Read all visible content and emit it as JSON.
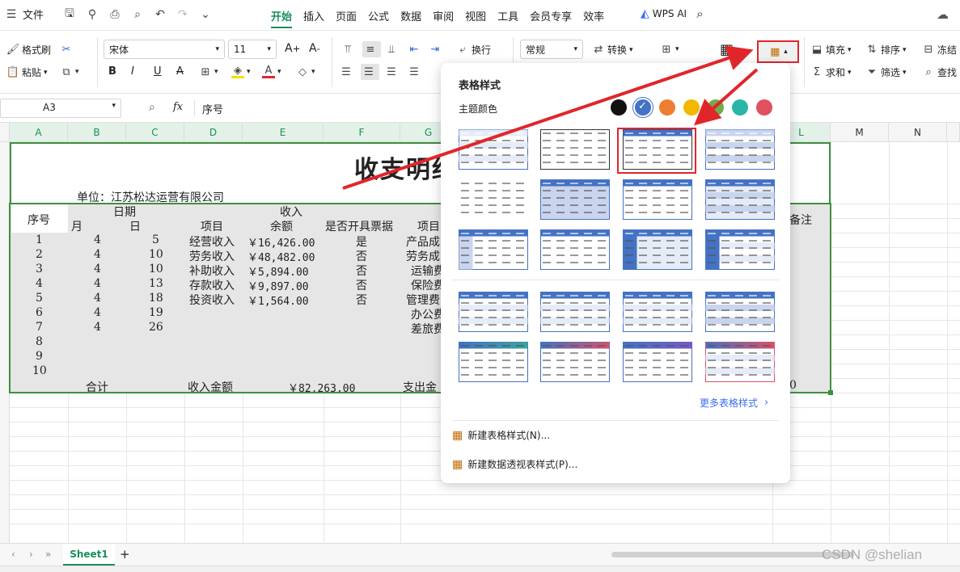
{
  "menu": {
    "file_label": "文件",
    "tabs": [
      "开始",
      "插入",
      "页面",
      "公式",
      "数据",
      "审阅",
      "视图",
      "工具",
      "会员专享",
      "效率"
    ],
    "wps_ai": "WPS AI"
  },
  "ribbon": {
    "format_painter": "格式刷",
    "paste": "粘贴",
    "font_name": "宋体",
    "font_size": "11",
    "bold": "B",
    "italic": "I",
    "underline": "U",
    "strike": "A",
    "wrap": "换行",
    "number_format": "常规",
    "convert": "转换",
    "fill": "填充",
    "sort": "排序",
    "freeze": "冻结",
    "sum": "求和",
    "filter": "筛选",
    "find": "查找"
  },
  "formula_bar": {
    "cell_ref": "A3",
    "fx": "fx",
    "content": "序号"
  },
  "columns": [
    "A",
    "B",
    "C",
    "D",
    "E",
    "F",
    "G",
    "L",
    "M",
    "N"
  ],
  "sheet": {
    "title": "收支明细",
    "unit": "单位：江苏松达运营有限公司",
    "header_seq": "序号",
    "header_date": "日期",
    "header_income": "收入",
    "header_month": "月",
    "header_day": "日",
    "header_item": "项目",
    "header_amount": "余额",
    "header_invoice": "是否开具票据",
    "header_item2": "项目",
    "header_note": "备注",
    "rows": [
      {
        "seq": "1",
        "m": "4",
        "d": "5",
        "item": "经营收入",
        "amt": "￥16,426.00",
        "inv": "是",
        "exp": "产品成"
      },
      {
        "seq": "2",
        "m": "4",
        "d": "10",
        "item": "劳务收入",
        "amt": "￥48,482.00",
        "inv": "否",
        "exp": "劳务成"
      },
      {
        "seq": "3",
        "m": "4",
        "d": "10",
        "item": "补助收入",
        "amt": "￥5,894.00",
        "inv": "否",
        "exp": "运输费"
      },
      {
        "seq": "4",
        "m": "4",
        "d": "13",
        "item": "存款收入",
        "amt": "￥9,897.00",
        "inv": "否",
        "exp": "保险费"
      },
      {
        "seq": "5",
        "m": "4",
        "d": "18",
        "item": "投资收入",
        "amt": "￥1,564.00",
        "inv": "否",
        "exp": "管理费"
      },
      {
        "seq": "6",
        "m": "4",
        "d": "19",
        "item": "",
        "amt": "",
        "inv": "",
        "exp": "办公费"
      },
      {
        "seq": "7",
        "m": "4",
        "d": "26",
        "item": "",
        "amt": "",
        "inv": "",
        "exp": "差旅费"
      },
      {
        "seq": "8",
        "m": "",
        "d": "",
        "item": "",
        "amt": "",
        "inv": "",
        "exp": ""
      },
      {
        "seq": "9",
        "m": "",
        "d": "",
        "item": "",
        "amt": "",
        "inv": "",
        "exp": ""
      },
      {
        "seq": "10",
        "m": "",
        "d": "",
        "item": "",
        "amt": "",
        "inv": "",
        "exp": ""
      }
    ],
    "total_label": "合计",
    "income_total_label": "收入金额",
    "income_total": "￥82,263.00",
    "expense_total_label": "支出金",
    "tail_value": "0"
  },
  "popup": {
    "title": "表格样式",
    "theme_label": "主题颜色",
    "theme_colors": [
      "#111111",
      "#4472c4",
      "#ed7d31",
      "#f2b800",
      "#70ad47",
      "#2bb5a8",
      "#e0515e"
    ],
    "more_styles": "更多表格样式",
    "new_table_style": "新建表格样式(N)...",
    "new_pivot_style": "新建数据透视表样式(P)..."
  },
  "sheet_tabs": {
    "active": "Sheet1",
    "add": "+"
  },
  "watermark": "CSDN @shelian",
  "accent": "#1a8f5a",
  "highlight_red": "#e0262b"
}
